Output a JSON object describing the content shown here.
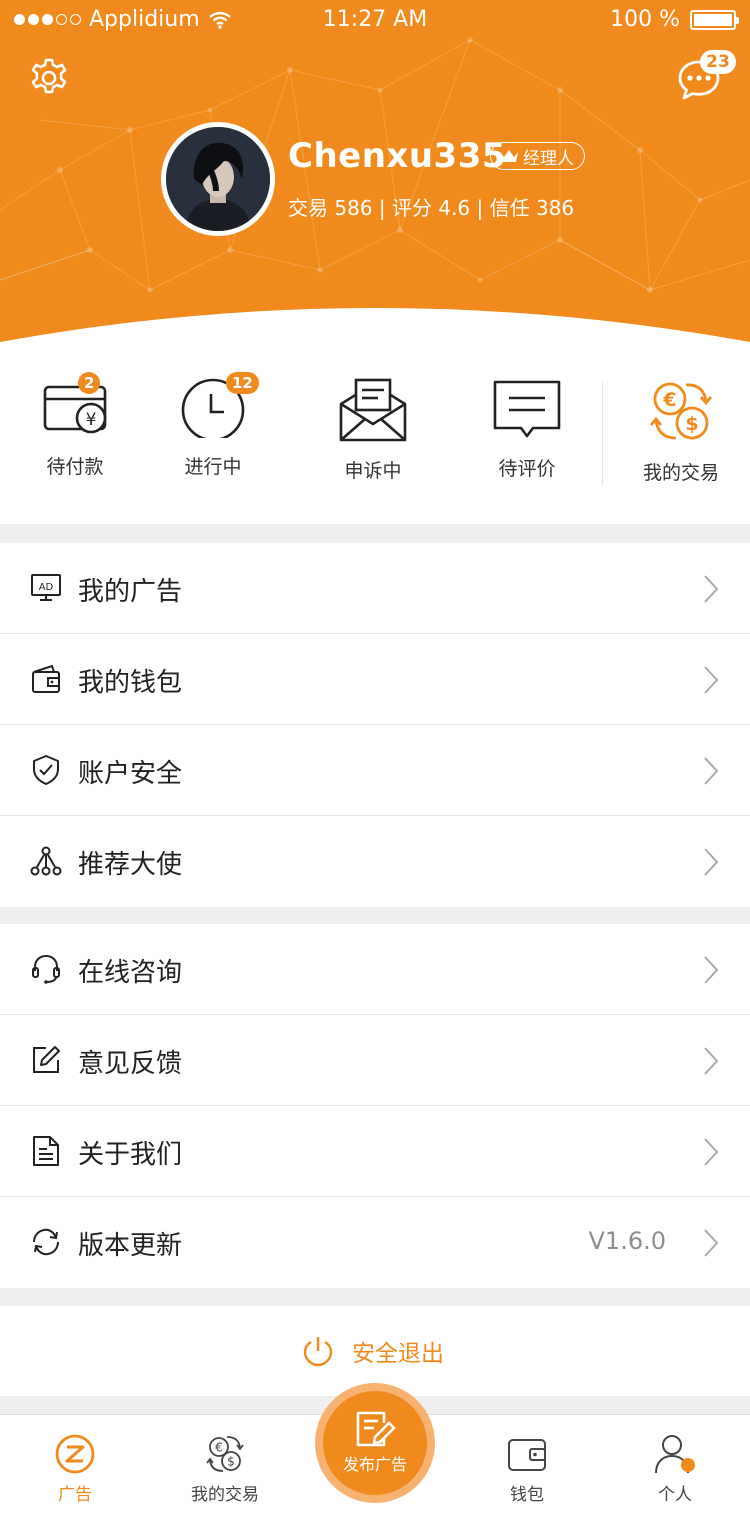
{
  "status_bar": {
    "carrier": "Applidium",
    "time": "11:27 AM",
    "battery": "100 %"
  },
  "header": {
    "message_count": "23",
    "username": "Chenxu335",
    "role": "经理人",
    "stats": "交易 586 | 评分 4.6 | 信任 386"
  },
  "quick_actions": [
    {
      "label": "待付款",
      "badge": "2"
    },
    {
      "label": "进行中",
      "badge": "12"
    },
    {
      "label": "申诉中"
    },
    {
      "label": "待评价"
    },
    {
      "label": "我的交易"
    }
  ],
  "menu_group1": [
    {
      "label": "我的广告",
      "icon": "ad-icon"
    },
    {
      "label": "我的钱包",
      "icon": "wallet-icon"
    },
    {
      "label": "账户安全",
      "icon": "shield-icon"
    },
    {
      "label": "推荐大使",
      "icon": "network-icon"
    }
  ],
  "menu_group2": [
    {
      "label": "在线咨询",
      "icon": "headset-icon"
    },
    {
      "label": "意见反馈",
      "icon": "edit-icon"
    },
    {
      "label": "关于我们",
      "icon": "document-icon"
    },
    {
      "label": "版本更新",
      "icon": "refresh-icon",
      "value": "V1.6.0"
    }
  ],
  "logout": "安全退出",
  "tabbar": [
    {
      "label": "广告",
      "active": true
    },
    {
      "label": "我的交易"
    },
    {
      "label": "发布广告"
    },
    {
      "label": "钱包"
    },
    {
      "label": "个人"
    }
  ],
  "colors": {
    "accent": "#f18a1c",
    "background": "#efefef",
    "divider": "#e6e6e6"
  }
}
